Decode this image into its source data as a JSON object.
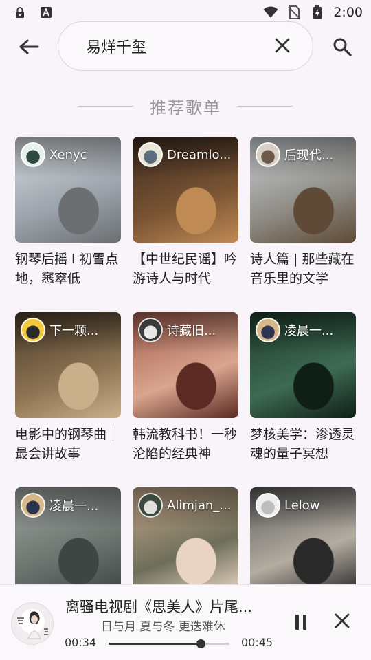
{
  "status_bar": {
    "time": "2:00",
    "left_icons": [
      "lock-icon",
      "keyboard-a-icon"
    ],
    "right_icons": [
      "wifi-icon",
      "no-sim-icon",
      "battery-charging-icon"
    ]
  },
  "search": {
    "query": "易烊千玺",
    "back_icon": "arrow-left-icon",
    "clear_icon": "close-icon",
    "search_icon": "search-icon"
  },
  "section": {
    "title": "推荐歌单"
  },
  "playlists": [
    {
      "owner": "Xenyc",
      "title": "钢琴后摇 l 初雪点地，窸窣低",
      "palette": [
        "#d8dde2",
        "#9aa2aa",
        "#6b6f72"
      ],
      "avatar": [
        "#e7f1ec",
        "#2f4a3e"
      ]
    },
    {
      "owner": "Dreamlo...",
      "title": "【中世纪民谣】吟游诗人与时代",
      "palette": [
        "#3b2a1f",
        "#7a5433",
        "#c08a55"
      ],
      "avatar": [
        "#e9e4d6",
        "#5a6d7e"
      ]
    },
    {
      "owner": "后现代...",
      "title": "诗人篇 | 那些藏在音乐里的文学",
      "palette": [
        "#cdd2d6",
        "#8e8b84",
        "#5e4a36"
      ],
      "avatar": [
        "#d7d0c6",
        "#6d5a48"
      ]
    },
    {
      "owner": "下一颗...",
      "title": "电影中的钢琴曲｜最会讲故事",
      "palette": [
        "#4a3a2a",
        "#8c7352",
        "#c9b08a"
      ],
      "avatar": [
        "#f3c83a",
        "#2a2a2a"
      ]
    },
    {
      "owner": "诗藏旧...",
      "title": "韩流教科书！一秒沦陷的经典神",
      "palette": [
        "#a25b4d",
        "#d9a58e",
        "#5b2a22"
      ],
      "avatar": [
        "#3a3a3a",
        "#e7e7e7"
      ]
    },
    {
      "owner": "凌晨一...",
      "title": "梦核美学：渗透灵魂的量子冥想",
      "palette": [
        "#1e3a2b",
        "#3d6a52",
        "#0f1f16"
      ],
      "avatar": [
        "#d7b78a",
        "#2b3550"
      ]
    },
    {
      "owner": "凌晨一...",
      "title": "",
      "palette": [
        "#9fa6a2",
        "#6b736f",
        "#3f4542"
      ],
      "avatar": [
        "#d7b78a",
        "#2b3550"
      ]
    },
    {
      "owner": "Alimjan_...",
      "title": "",
      "palette": [
        "#c9a98b",
        "#6e6e5a",
        "#e9d4c4"
      ],
      "avatar": [
        "#3b4a3e",
        "#e0e0e0"
      ]
    },
    {
      "owner": "Lelow",
      "title": "",
      "palette": [
        "#5a5a5a",
        "#b3aca0",
        "#2a2a2a"
      ],
      "avatar": [
        "#eeeeee",
        "#bdbdbd"
      ]
    }
  ],
  "player": {
    "title": "离骚电视剧《思美人》片尾...",
    "artist": "日与月 夏与冬 更迭难休",
    "time_current": "00:34",
    "time_total": "00:45",
    "progress": 0.76,
    "pause_icon": "pause-icon",
    "close_icon": "close-icon"
  }
}
